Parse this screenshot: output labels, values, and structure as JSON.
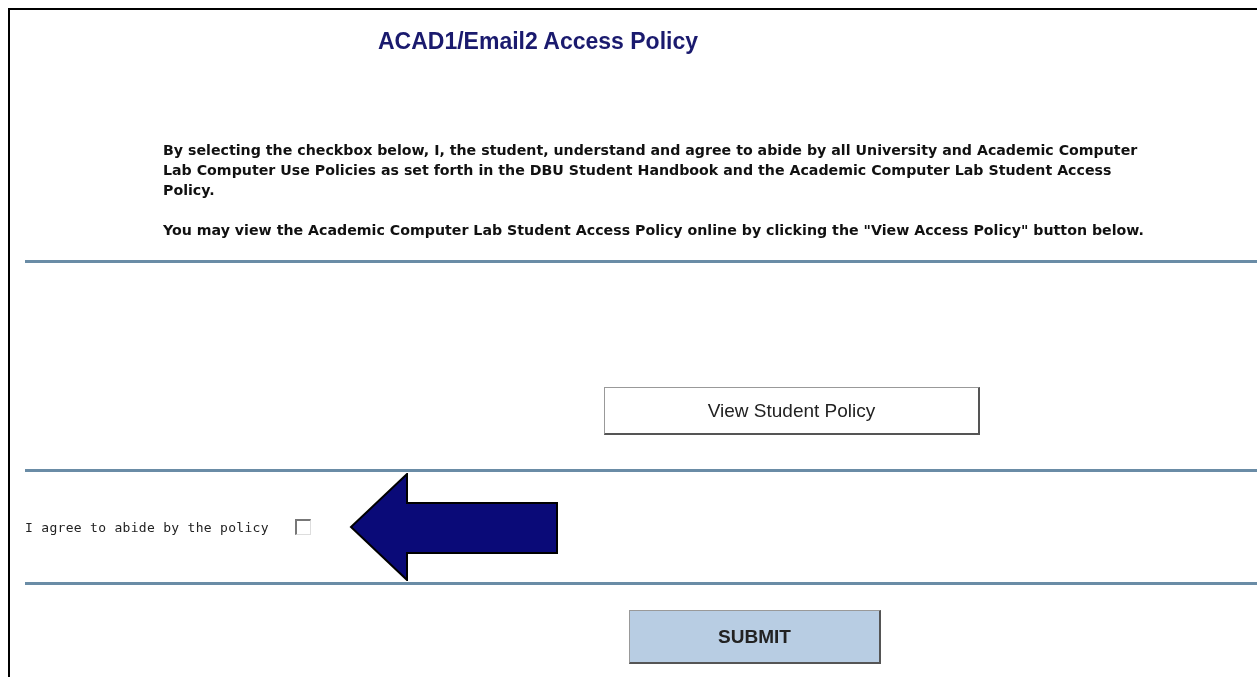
{
  "title": "ACAD1/Email2 Access Policy",
  "paragraphs": [
    "By selecting the checkbox below, I, the student, understand and agree to abide by all University and Academic Computer Lab Computer Use Policies as set forth in the DBU Student Handbook and the Academic Computer Lab Student Access Policy.",
    "You may view the Academic Computer Lab Student Access Policy online by clicking the \"View Access Policy\" button below."
  ],
  "view_button": "View Student Policy",
  "agree": {
    "label": "I agree to abide by the policy",
    "checked": false
  },
  "submit_button": "SUBMIT"
}
